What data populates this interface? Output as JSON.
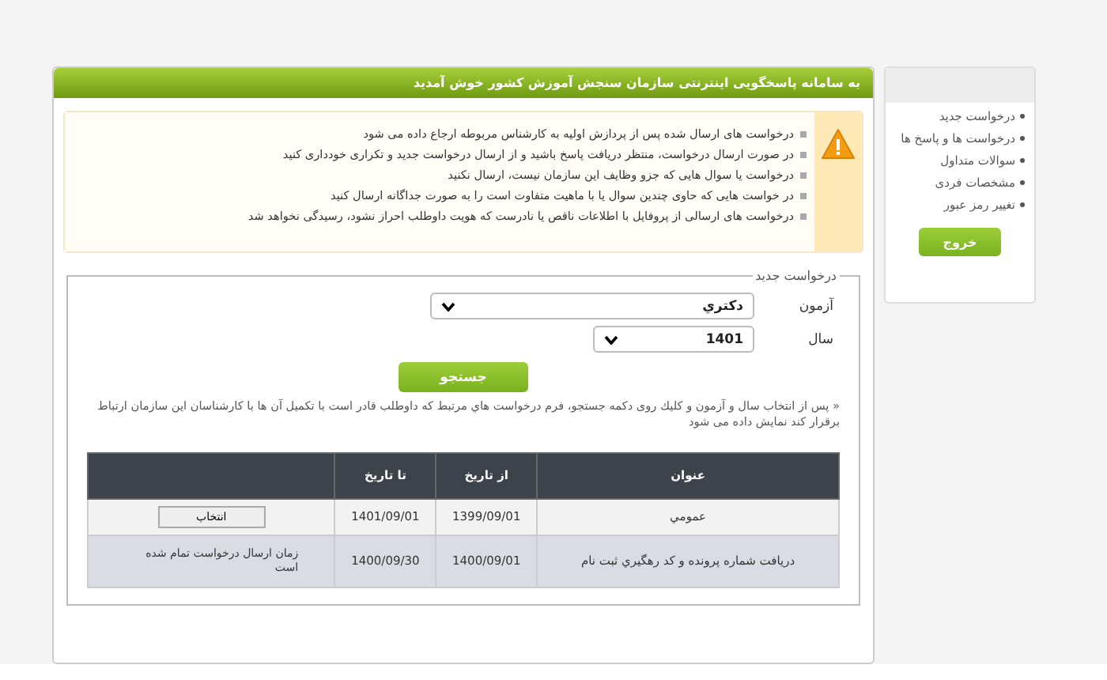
{
  "header": {
    "title": "به سامانه پاسخگویی اینترنتی سازمان سنجش آموزش کشور خوش آمدید"
  },
  "notices": [
    "درخواست های ارسال شده پس از پردازش اولیه به کارشناس مربوطه ارجاع داده می شود",
    "در صورت ارسال درخواست، منتظر دریافت پاسخ باشید و از ارسال درخواست جدید و تکراری خودداری کنید",
    "درخواست یا سوال هایی که جزو وظایف این سازمان نیست، ارسال نکنید",
    "در خواست هایی که حاوی چندین سوال یا با ماهیت متفاوت است را به صورت جداگانه ارسال کنید",
    "درخواست های ارسالی از پروفایل با اطلاعات ناقص یا نادرست که هویت داوطلب احراز نشود، رسیدگی نخواهد شد"
  ],
  "form": {
    "legend": "درخواست جدید",
    "fields": [
      {
        "label": "آزمون",
        "value": "دکتري",
        "kind": "wide"
      },
      {
        "label": "سال",
        "value": "1401",
        "kind": "narrow"
      }
    ],
    "search_button": "جستجو",
    "note": "« پس از انتخاب سال و آزمون و کلیك روی دکمه جستجو، فرم درخواست هاي مرتبط که داوطلب قادر است با تکمیل آن ها با کارشناسان این سازمان ارتباط برقرار کند نمایش داده می شود"
  },
  "table": {
    "columns": [
      "عنوان",
      "از تاریخ",
      "تا تاریخ",
      ""
    ],
    "rows": [
      {
        "title": "عمومي",
        "from": "1399/09/01",
        "to": "1401/09/01",
        "action": {
          "kind": "button",
          "text": "انتخاب"
        }
      },
      {
        "title": "دریافت شماره پرونده و کد رهگيري ثبت نام",
        "from": "1400/09/01",
        "to": "1400/09/30",
        "action": {
          "kind": "text",
          "text": "زمان ارسال درخواست تمام شده است"
        }
      }
    ]
  },
  "sidebar": {
    "items": [
      "درخواست جدید",
      "درخواست ها و پاسخ ها",
      "سوالات متداول",
      "مشخصات فردی",
      "تغییر رمز عبور"
    ],
    "exit_button": "خروج"
  }
}
